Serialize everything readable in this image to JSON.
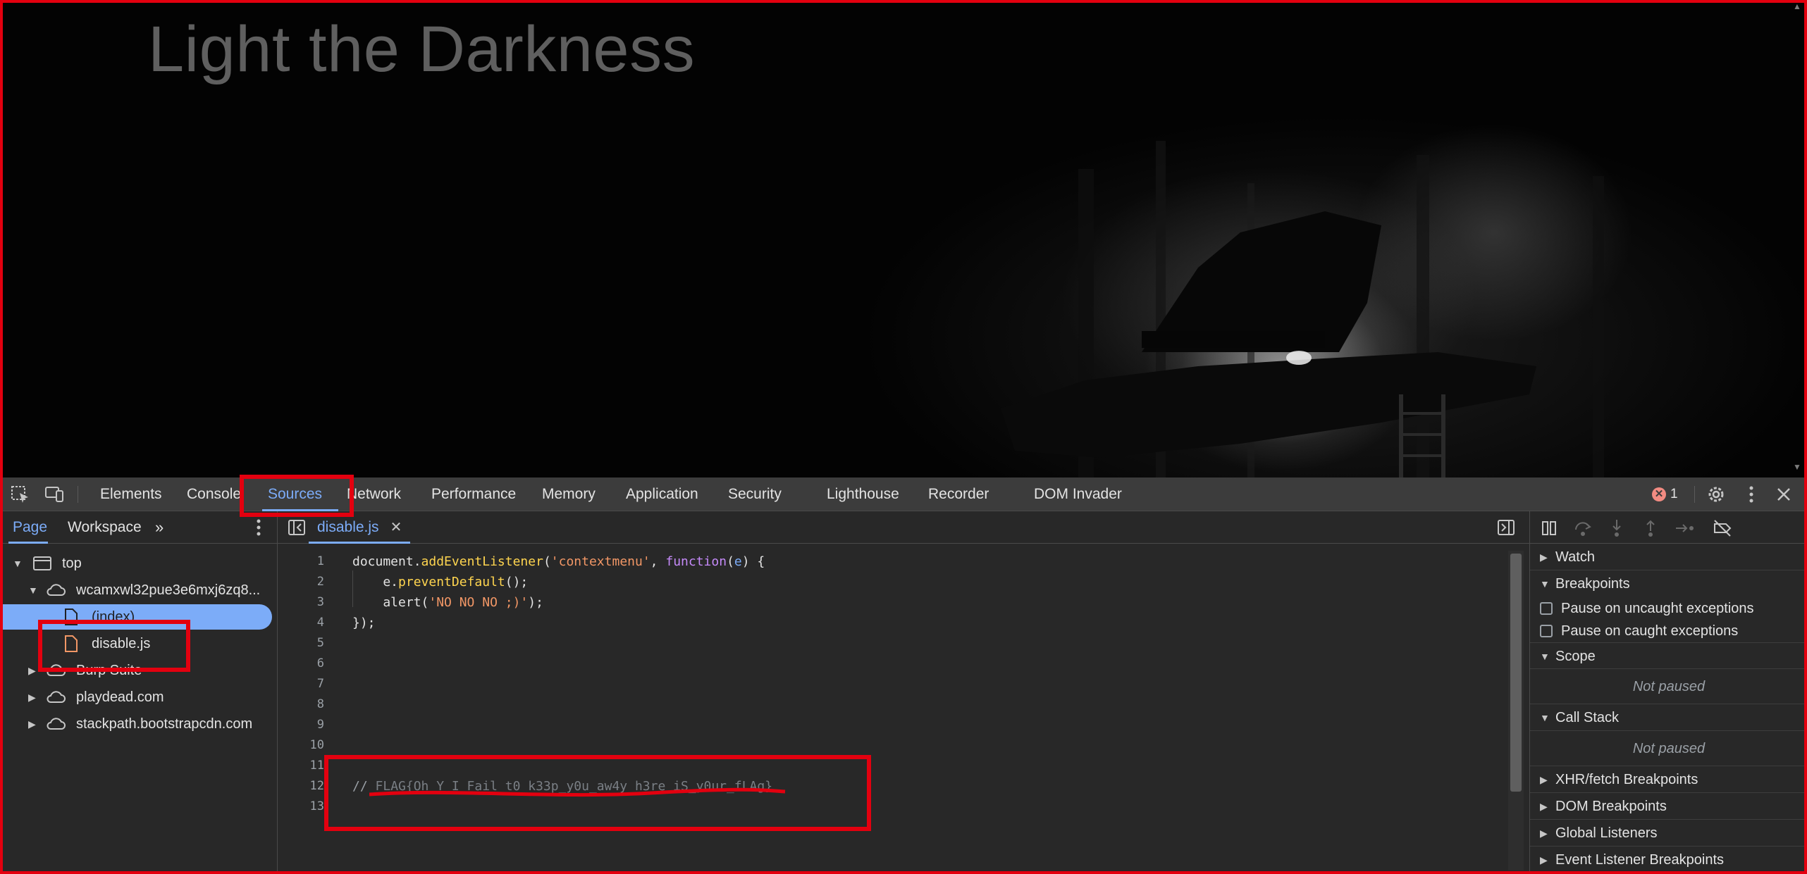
{
  "page": {
    "title": "Light the Darkness"
  },
  "devtools": {
    "main_tabs": [
      {
        "label": "Elements"
      },
      {
        "label": "Console"
      },
      {
        "label": "Sources"
      },
      {
        "label": "Network"
      },
      {
        "label": "Performance"
      },
      {
        "label": "Memory"
      },
      {
        "label": "Application"
      },
      {
        "label": "Security"
      },
      {
        "label": "Lighthouse"
      },
      {
        "label": "Recorder"
      },
      {
        "label": "DOM Invader"
      }
    ],
    "active_main_tab": "Sources",
    "error_count": "1",
    "icons": {
      "inspect": "inspect-element-icon",
      "device": "device-toolbar-icon",
      "error": "error-circle-icon",
      "settings": "gear-icon",
      "more": "kebab-menu-icon",
      "close": "close-icon"
    }
  },
  "navigator": {
    "tabs": [
      {
        "label": "Page"
      },
      {
        "label": "Workspace"
      }
    ],
    "active_tab": "Page",
    "tree": [
      {
        "label": "top",
        "icon": "frame-icon",
        "expanded": true
      },
      {
        "label": "wcamxwl32pue3e6mxj6zq8...",
        "icon": "cloud-icon",
        "expanded": true
      },
      {
        "label": "(index)",
        "icon": "file-icon",
        "selected": true
      },
      {
        "label": "disable.js",
        "icon": "js-file-icon"
      },
      {
        "label": "Burp Suite",
        "icon": "cloud-icon",
        "expanded": false
      },
      {
        "label": "playdead.com",
        "icon": "cloud-icon",
        "expanded": false
      },
      {
        "label": "stackpath.bootstrapcdn.com",
        "icon": "cloud-icon",
        "expanded": false
      }
    ]
  },
  "editor": {
    "open_file": "disable.js",
    "line_numbers": [
      "1",
      "2",
      "3",
      "4",
      "5",
      "6",
      "7",
      "8",
      "9",
      "10",
      "11",
      "12",
      "13"
    ],
    "code": {
      "l1_a": "document.",
      "l1_fn": "addEventListener",
      "l1_b": "(",
      "l1_str": "'contextmenu'",
      "l1_c": ", ",
      "l1_kw": "function",
      "l1_d": "(",
      "l1_param": "e",
      "l1_e": ") {",
      "l2_a": "    e.",
      "l2_fn": "preventDefault",
      "l2_b": "();",
      "l3_a": "    alert(",
      "l3_str": "'NO NO NO ;)'",
      "l3_b": ");",
      "l4": "});",
      "l12_prefix": "// ",
      "l12_flag": "FLAG{Oh_Y_I_Fail_t0_k33p_y0u_aw4y_h3re_iS_y0ur_fLAg}"
    }
  },
  "debugger": {
    "panes": {
      "watch": "Watch",
      "breakpoints": "Breakpoints",
      "pause_uncaught": "Pause on uncaught exceptions",
      "pause_caught": "Pause on caught exceptions",
      "scope": "Scope",
      "scope_status": "Not paused",
      "call_stack": "Call Stack",
      "call_stack_status": "Not paused",
      "xhr": "XHR/fetch Breakpoints",
      "dom": "DOM Breakpoints",
      "global": "Global Listeners",
      "event": "Event Listener Breakpoints"
    },
    "icons": [
      "pause-icon",
      "step-over-icon",
      "step-into-icon",
      "step-out-icon",
      "step-icon",
      "deactivate-breakpoints-icon"
    ]
  },
  "colors": {
    "accent": "#7cacf8",
    "annotation": "#e3000f",
    "devtools_bg": "#282828",
    "toolbar_bg": "#3c3c3c"
  }
}
